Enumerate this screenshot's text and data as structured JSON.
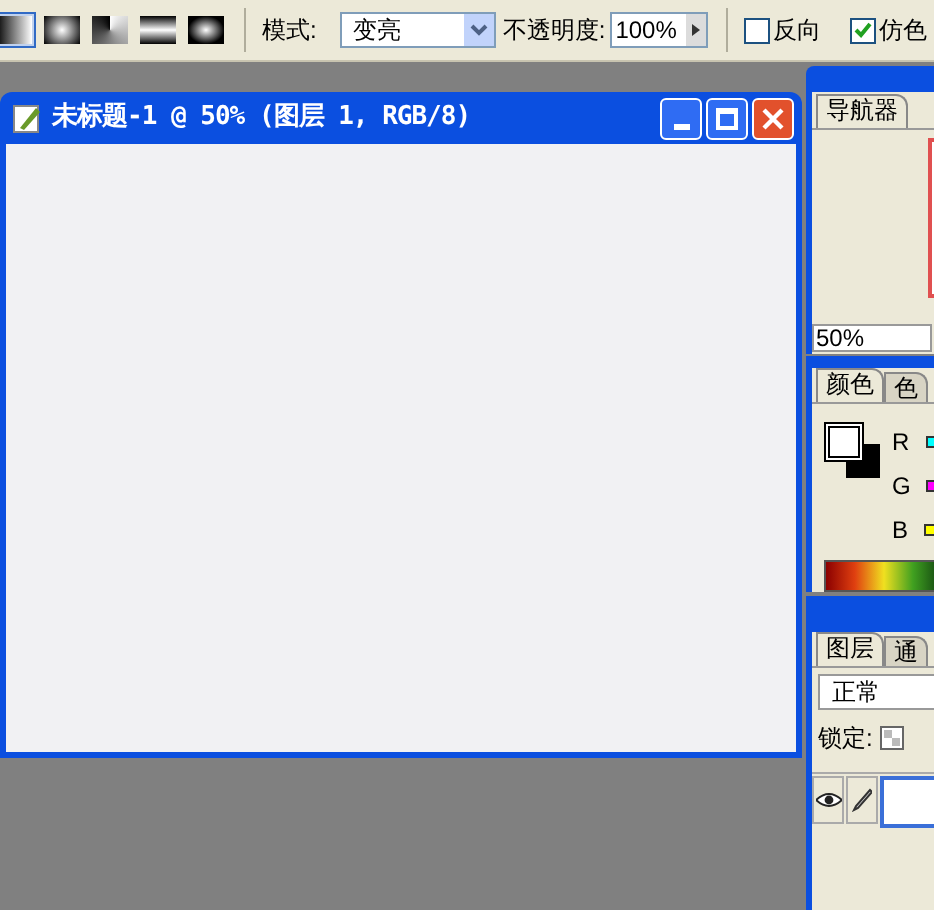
{
  "options_bar": {
    "gradient_types": [
      {
        "kind": "linear",
        "selected": true
      },
      {
        "kind": "radial",
        "selected": false
      },
      {
        "kind": "angle",
        "selected": false
      },
      {
        "kind": "reflected",
        "selected": false
      },
      {
        "kind": "diamond",
        "selected": false
      }
    ],
    "mode_label": "模式:",
    "mode_value": "变亮",
    "opacity_label": "不透明度:",
    "opacity_value": "100%",
    "checkboxes": [
      {
        "label": "反向",
        "checked": false
      },
      {
        "label": "仿色",
        "checked": true
      }
    ]
  },
  "document": {
    "title": "未标题-1 @ 50% (图层 1, RGB/8)"
  },
  "navigator": {
    "tabs": [
      {
        "label": "导航器",
        "selected": true
      }
    ],
    "zoom": "50%"
  },
  "color": {
    "tabs": [
      {
        "label": "颜色",
        "selected": true
      },
      {
        "label": "色",
        "selected": false
      }
    ],
    "channels": [
      {
        "label": "R",
        "color": "#00ffff"
      },
      {
        "label": "G",
        "color": "#ff00ff"
      },
      {
        "label": "B",
        "color": "#ffff00"
      }
    ]
  },
  "layers": {
    "tabs": [
      {
        "label": "图层",
        "selected": true
      },
      {
        "label": "通",
        "selected": false
      }
    ],
    "blend_mode": "正常",
    "lock_label": "锁定:"
  }
}
